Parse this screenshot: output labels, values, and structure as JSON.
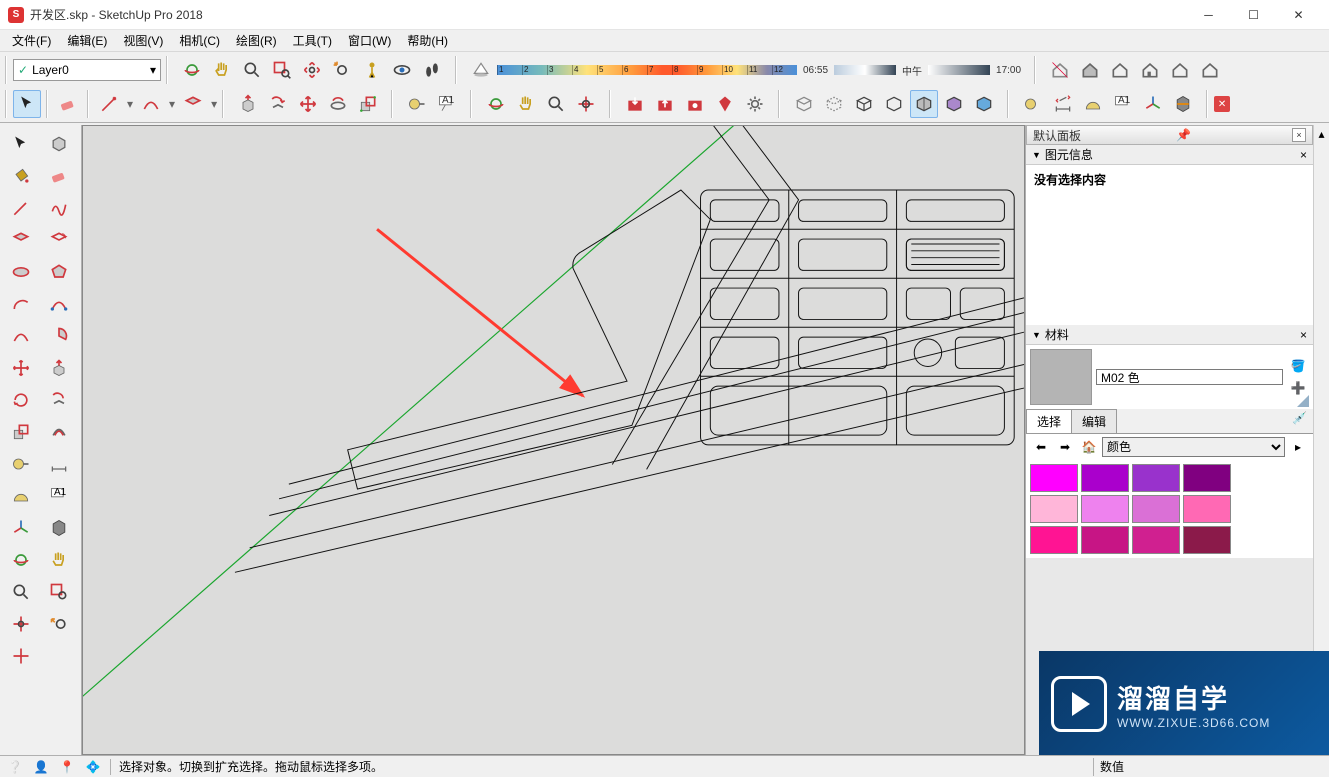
{
  "titlebar": {
    "app_icon": "S",
    "title": "开发区.skp - SketchUp Pro 2018"
  },
  "menu": {
    "file": "文件(F)",
    "edit": "编辑(E)",
    "view": "视图(V)",
    "camera": "相机(C)",
    "draw": "绘图(R)",
    "tools": "工具(T)",
    "window": "窗口(W)",
    "help": "帮助(H)"
  },
  "layer": {
    "current": "Layer0"
  },
  "timebar": {
    "ticks": [
      "1",
      "2",
      "3",
      "4",
      "5",
      "6",
      "7",
      "8",
      "9",
      "10",
      "11",
      "12"
    ],
    "left_time": "06:55",
    "mid_label": "中午",
    "right_time": "17:00"
  },
  "panels": {
    "tray_title": "默认面板",
    "entity": {
      "title": "图元信息",
      "empty": "没有选择内容"
    },
    "material": {
      "title": "材料",
      "name": "M02 色",
      "tab_select": "选择",
      "tab_edit": "编辑",
      "palette_select": "颜色",
      "colors": [
        "#ff00ff",
        "#aa00cc",
        "#9932cc",
        "#800080",
        "#ffb6d9",
        "#ee82ee",
        "#da70d6",
        "#ff69b4",
        "#ff1493",
        "#c71585",
        "#d02090",
        "#8b1a4a"
      ]
    }
  },
  "statusbar": {
    "hint": "选择对象。切换到扩充选择。拖动鼠标选择多项。",
    "measure_label": "数值"
  },
  "watermark": {
    "line1": "溜溜自学",
    "line2": "WWW.ZIXUE.3D66.COM"
  }
}
